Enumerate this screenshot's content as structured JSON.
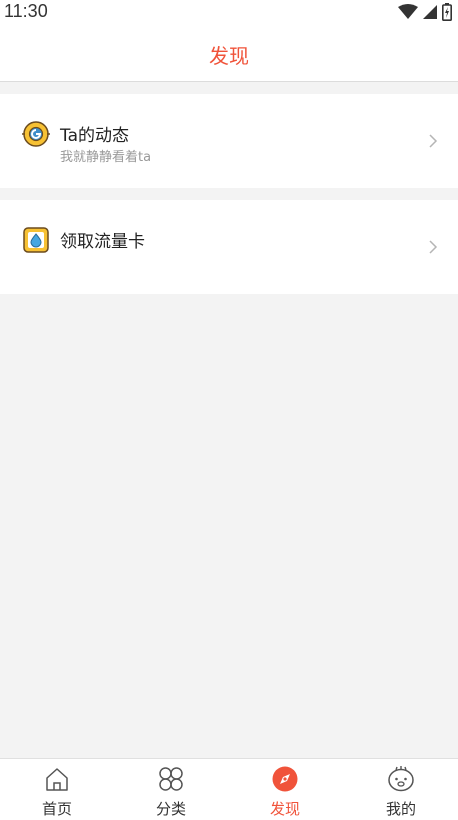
{
  "status_bar": {
    "time": "11:30"
  },
  "header": {
    "title": "发现"
  },
  "discover_items": [
    {
      "title": "Ta的动态",
      "subtitle": "我就静静看着ta",
      "icon": "eye-radar-icon"
    },
    {
      "title": "领取流量卡",
      "subtitle": "",
      "icon": "water-drop-card-icon"
    }
  ],
  "tabs": [
    {
      "label": "首页",
      "icon": "home-icon"
    },
    {
      "label": "分类",
      "icon": "grid-icon"
    },
    {
      "label": "发现",
      "icon": "compass-icon",
      "active": true
    },
    {
      "label": "我的",
      "icon": "smiley-face-icon"
    }
  ],
  "colors": {
    "accent": "#f0533a",
    "background": "#f3f3f3"
  }
}
